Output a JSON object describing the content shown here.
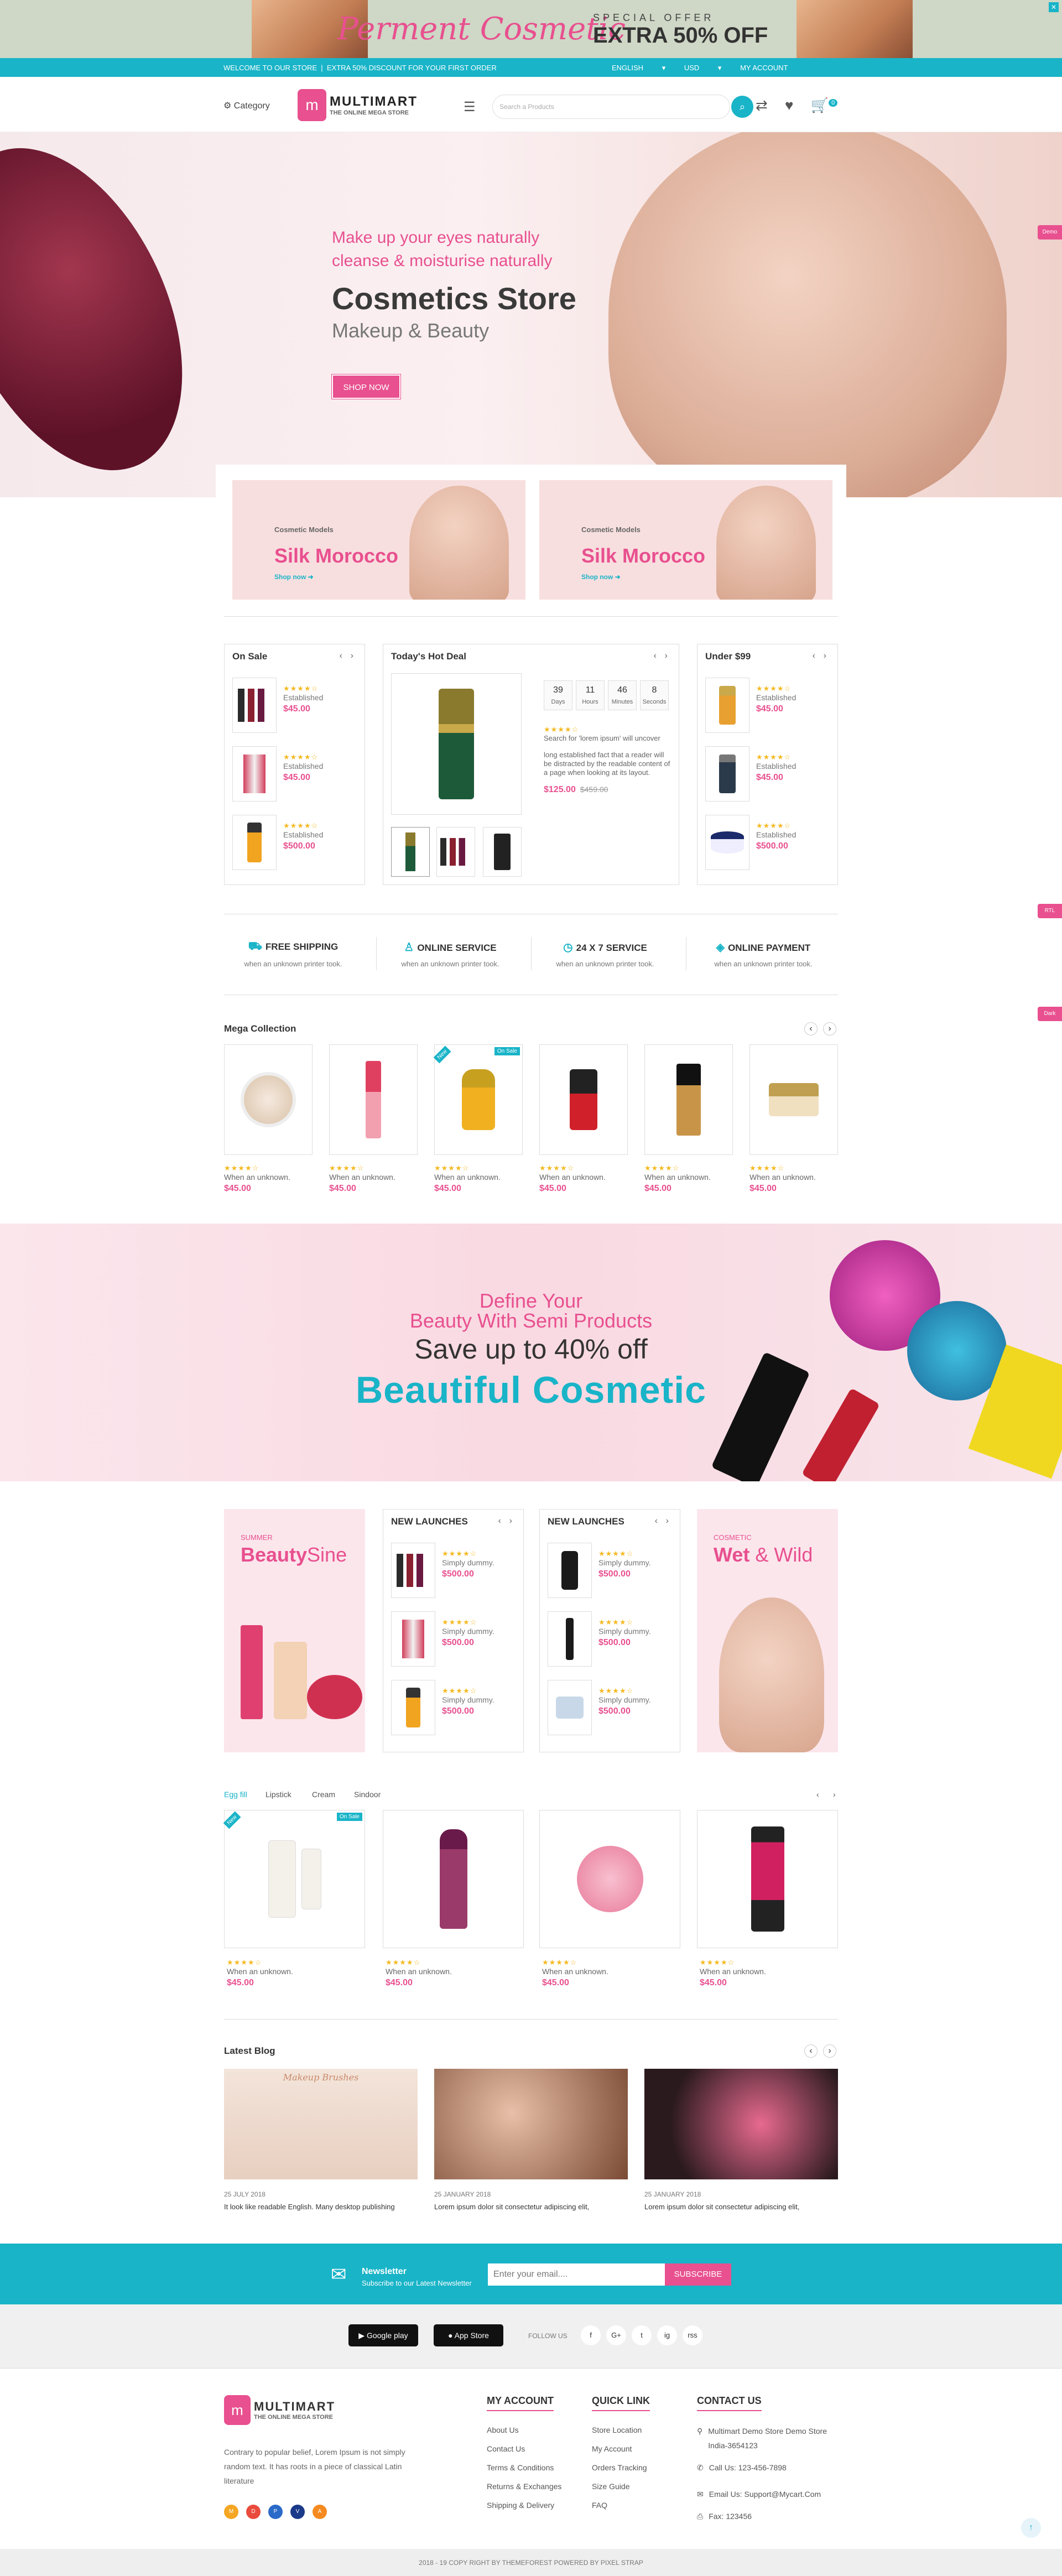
{
  "promo": {
    "brand": "Perment Cosmetic",
    "special": "SPECIAL OFFER",
    "extra": "EXTRA 50% OFF"
  },
  "topbar": {
    "welcome": "WELCOME TO OUR STORE",
    "discount": "EXTRA 50% DISCOUNT FOR YOUR FIRST ORDER",
    "language": "ENGLISH",
    "currency": "USD",
    "account": "MY ACCOUNT"
  },
  "header": {
    "category": "Category",
    "logo_name": "MULTIMART",
    "logo_tag": "THE ONLINE MEGA STORE",
    "search_placeholder": "Search a Products",
    "cart_count": "0"
  },
  "hero": {
    "line1": "Make up your eyes naturally",
    "line2": "cleanse & moisturise naturally",
    "title": "Cosmetics Store",
    "subtitle": "Makeup & Beauty",
    "button": "SHOP NOW"
  },
  "floating": {
    "demo": "Demo",
    "rtl": "RTL",
    "dark": "Dark"
  },
  "small_banners": [
    {
      "kicker": "Cosmetic Models",
      "title": "Silk Morocco",
      "link": "Shop now"
    },
    {
      "kicker": "Cosmetic Models",
      "title": "Silk Morocco",
      "link": "Shop now"
    }
  ],
  "on_sale": {
    "title": "On Sale",
    "items": [
      {
        "name": "Established",
        "price": "$45.00",
        "rating": 4
      },
      {
        "name": "Established",
        "price": "$45.00",
        "rating": 4
      },
      {
        "name": "Established",
        "price": "$500.00",
        "rating": 4
      }
    ]
  },
  "hot_deal": {
    "title": "Today's Hot Deal",
    "countdown": [
      {
        "v": "39",
        "l": "Days"
      },
      {
        "v": "11",
        "l": "Hours"
      },
      {
        "v": "46",
        "l": "Minutes"
      },
      {
        "v": "8",
        "l": "Seconds"
      }
    ],
    "name": "Search for 'lorem ipsum' will uncover",
    "desc": "long established fact that a reader will be distracted by the readable content of a page when looking at its layout.",
    "price": "$125.00",
    "old_price": "$459.00",
    "rating": 4
  },
  "under99": {
    "title": "Under $99",
    "items": [
      {
        "name": "Established",
        "price": "$45.00",
        "rating": 4
      },
      {
        "name": "Established",
        "price": "$45.00",
        "rating": 4
      },
      {
        "name": "Established",
        "price": "$500.00",
        "rating": 4
      }
    ]
  },
  "features": [
    {
      "title": "FREE SHIPPING",
      "sub": "when an unknown printer took."
    },
    {
      "title": "ONLINE SERVICE",
      "sub": "when an unknown printer took."
    },
    {
      "title": "24 X 7 SERVICE",
      "sub": "when an unknown printer took."
    },
    {
      "title": "ONLINE PAYMENT",
      "sub": "when an unknown printer took."
    }
  ],
  "mega": {
    "title": "Mega Collection",
    "items": [
      {
        "name": "When an unknown.",
        "price": "$45.00",
        "rating": 4
      },
      {
        "name": "When an unknown.",
        "price": "$45.00",
        "rating": 4
      },
      {
        "name": "When an unknown.",
        "price": "$45.00",
        "rating": 4,
        "badge_new": "New",
        "badge_sale": "On Sale"
      },
      {
        "name": "When an unknown.",
        "price": "$45.00",
        "rating": 4
      },
      {
        "name": "When an unknown.",
        "price": "$45.00",
        "rating": 4
      },
      {
        "name": "When an unknown.",
        "price": "$45.00",
        "rating": 4
      }
    ]
  },
  "banner2": {
    "line1": "Define Your",
    "line2": "Beauty With Semi Products",
    "line3": "Save up to 40% off",
    "line4": "Beautiful Cosmetic"
  },
  "launch": {
    "left_banner": {
      "kicker": "SUMMER",
      "title": "Beauty",
      "title2": "Sine"
    },
    "right_banner": {
      "kicker": "COSMETIC",
      "title": "Wet",
      "title2": " & Wild"
    },
    "col1": {
      "title": "NEW LAUNCHES",
      "items": [
        {
          "name": "Simply dummy.",
          "price": "$500.00",
          "rating": 4
        },
        {
          "name": "Simply dummy.",
          "price": "$500.00",
          "rating": 4
        },
        {
          "name": "Simply dummy.",
          "price": "$500.00",
          "rating": 4
        }
      ]
    },
    "col2": {
      "title": "NEW LAUNCHES",
      "items": [
        {
          "name": "Simply dummy.",
          "price": "$500.00",
          "rating": 4
        },
        {
          "name": "Simply dummy.",
          "price": "$500.00",
          "rating": 4
        },
        {
          "name": "Simply dummy.",
          "price": "$500.00",
          "rating": 4
        }
      ]
    }
  },
  "tabs": {
    "labels": [
      "Egg fill",
      "Lipstick",
      "Cream",
      "Sindoor"
    ],
    "active": "Egg fill",
    "items": [
      {
        "name": "When an unknown.",
        "price": "$45.00",
        "rating": 4,
        "badge_new": "New",
        "badge_sale": "On Sale"
      },
      {
        "name": "When an unknown.",
        "price": "$45.00",
        "rating": 4
      },
      {
        "name": "When an unknown.",
        "price": "$45.00",
        "rating": 4
      },
      {
        "name": "When an unknown.",
        "price": "$45.00",
        "rating": 4
      }
    ]
  },
  "blog": {
    "title": "Latest Blog",
    "posts": [
      {
        "image_text": "Makeup Brushes",
        "date": "25 JULY 2018",
        "text": "It look like readable English. Many desktop publishing"
      },
      {
        "image_text": "",
        "date": "25 JANUARY 2018",
        "text": "Lorem ipsum dolor sit consectetur adipiscing elit,"
      },
      {
        "image_text": "",
        "date": "25 JANUARY 2018",
        "text": "Lorem ipsum dolor sit consectetur adipiscing elit,"
      }
    ]
  },
  "newsletter": {
    "title": "Newsletter",
    "sub": "Subscribe to our Latest Newsletter",
    "placeholder": "Enter your email....",
    "button": "SUBSCRIBE"
  },
  "apps": {
    "google": "Google play",
    "apple": "App Store",
    "follow": "FOLLOW US",
    "social": [
      "f",
      "G+",
      "t",
      "ig",
      "rss"
    ]
  },
  "footer": {
    "about": "Contrary to popular belief, Lorem Ipsum is not simply random text. It has roots in a piece of classical Latin literature",
    "payments": [
      "M",
      "D",
      "P",
      "V",
      "A"
    ],
    "account": {
      "title": "MY ACCOUNT",
      "links": [
        "About Us",
        "Contact Us",
        "Terms & Conditions",
        "Returns & Exchanges",
        "Shipping & Delivery"
      ]
    },
    "quick": {
      "title": "QUICK LINK",
      "links": [
        "Store Location",
        "My Account",
        "Orders Tracking",
        "Size Guide",
        "FAQ"
      ]
    },
    "contact": {
      "title": "CONTACT US",
      "address": "Multimart Demo Store Demo Store India-3654123",
      "phone": "Call Us: 123-456-7898",
      "email": "Email Us: Support@Mycart.Com",
      "fax": "Fax: 123456"
    }
  },
  "copyright": "2018 - 19 COPY RIGHT BY THEMEFOREST POWERED BY PIXEL STRAP",
  "colors": {
    "pink": "#e8508f",
    "teal": "#19b4c8"
  }
}
